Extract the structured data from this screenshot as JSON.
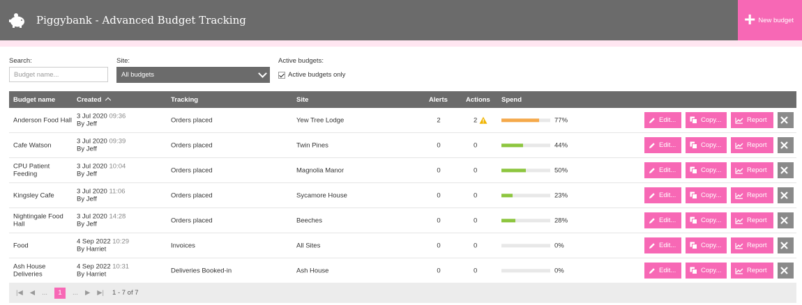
{
  "header": {
    "title": "Piggybank - Advanced Budget Tracking",
    "new_budget_label": "New budget",
    "brand_color": "#f768b5"
  },
  "filters": {
    "search_label": "Search:",
    "search_placeholder": "Budget name...",
    "search_value": "",
    "site_label": "Site:",
    "site_value": "All budgets",
    "active_label": "Active budgets:",
    "active_checkbox_label": "Active budgets only",
    "active_checked": true
  },
  "table": {
    "columns": {
      "name": "Budget name",
      "created": "Created",
      "tracking": "Tracking",
      "site": "Site",
      "alerts": "Alerts",
      "actions": "Actions",
      "spend": "Spend"
    },
    "row_buttons": {
      "edit": "Edit...",
      "copy": "Copy...",
      "report": "Report"
    },
    "rows": [
      {
        "name": "Anderson Food Hall",
        "date": "3 Jul 2020",
        "time": "09:36",
        "by": "By Jeff",
        "tracking": "Orders placed",
        "site": "Yew Tree Lodge",
        "alerts": "2",
        "actions": "2",
        "warning": true,
        "spend": 77,
        "spend_label": "77%",
        "bar_color": "#f5a94a"
      },
      {
        "name": "Cafe Watson",
        "date": "3 Jul 2020",
        "time": "09:39",
        "by": "By Jeff",
        "tracking": "Orders placed",
        "site": "Twin Pines",
        "alerts": "0",
        "actions": "0",
        "warning": false,
        "spend": 44,
        "spend_label": "44%",
        "bar_color": "#8dc63f"
      },
      {
        "name": "CPU Patient Feeding",
        "date": "3 Jul 2020",
        "time": "10:04",
        "by": "By Jeff",
        "tracking": "Orders placed",
        "site": "Magnolia Manor",
        "alerts": "0",
        "actions": "0",
        "warning": false,
        "spend": 50,
        "spend_label": "50%",
        "bar_color": "#8dc63f"
      },
      {
        "name": "Kingsley Cafe",
        "date": "3 Jul 2020",
        "time": "11:06",
        "by": "By Jeff",
        "tracking": "Orders placed",
        "site": "Sycamore House",
        "alerts": "0",
        "actions": "0",
        "warning": false,
        "spend": 23,
        "spend_label": "23%",
        "bar_color": "#8dc63f"
      },
      {
        "name": "Nightingale Food Hall",
        "date": "3 Jul 2020",
        "time": "14:28",
        "by": "By Jeff",
        "tracking": "Orders placed",
        "site": "Beeches",
        "alerts": "0",
        "actions": "0",
        "warning": false,
        "spend": 28,
        "spend_label": "28%",
        "bar_color": "#8dc63f"
      },
      {
        "name": "Food",
        "date": "4 Sep 2022",
        "time": "10:29",
        "by": "By Harriet",
        "tracking": "Invoices",
        "site": "All Sites",
        "alerts": "0",
        "actions": "0",
        "warning": false,
        "spend": 0,
        "spend_label": "0%",
        "bar_color": "#8dc63f"
      },
      {
        "name": "Ash House Deliveries",
        "date": "4 Sep 2022",
        "time": "10:31",
        "by": "By Harriet",
        "tracking": "Deliveries Booked-in",
        "site": "Ash House",
        "alerts": "0",
        "actions": "0",
        "warning": false,
        "spend": 0,
        "spend_label": "0%",
        "bar_color": "#8dc63f"
      }
    ]
  },
  "pager": {
    "ellipsis": "...",
    "current_page": "1",
    "info": "1 - 7 of 7"
  }
}
